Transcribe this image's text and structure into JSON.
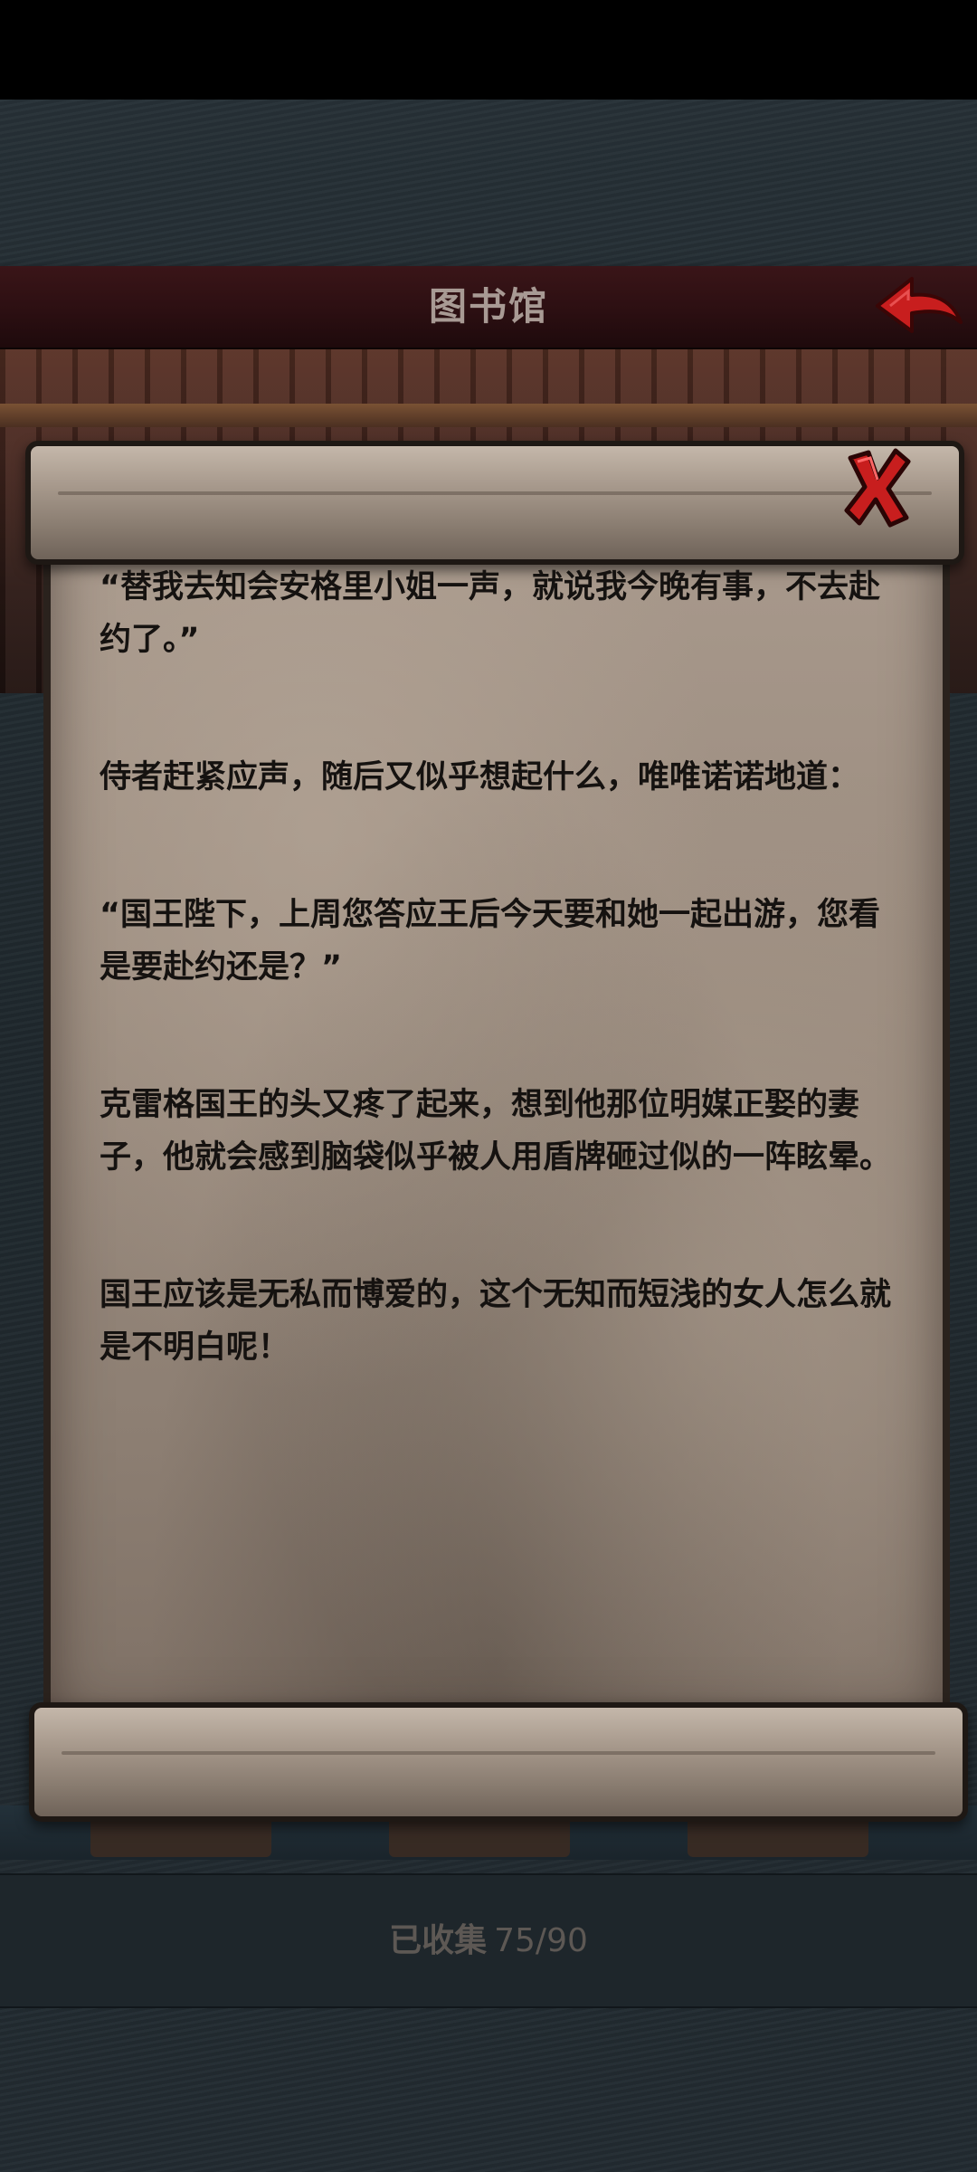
{
  "header": {
    "title": "图书馆"
  },
  "icons": {
    "back": "red-back-arrow-icon",
    "close": "red-x-close-icon"
  },
  "colors": {
    "accent_red": "#c81e1e",
    "title_bar": "#2c0f12",
    "parchment": "#9a8b7e",
    "text": "#151210"
  },
  "scroll": {
    "paragraphs": [
      "“替我去知会安格里小姐一声，就说我今晚有事，不去赴约了。”",
      "侍者赶紧应声，随后又似乎想起什么，唯唯诺诺地道：",
      "“国王陛下，上周您答应王后今天要和她一起出游，您看是要赴约还是？”",
      "克雷格国王的头又疼了起来，想到他那位明媒正娶的妻子，他就会感到脑袋似乎被人用盾牌砸过似的一阵眩晕。",
      "国王应该是无私而博爱的，这个无知而短浅的女人怎么就是不明白呢！"
    ]
  },
  "footer": {
    "collected_label": "已收集",
    "collected_value": "75/90"
  }
}
